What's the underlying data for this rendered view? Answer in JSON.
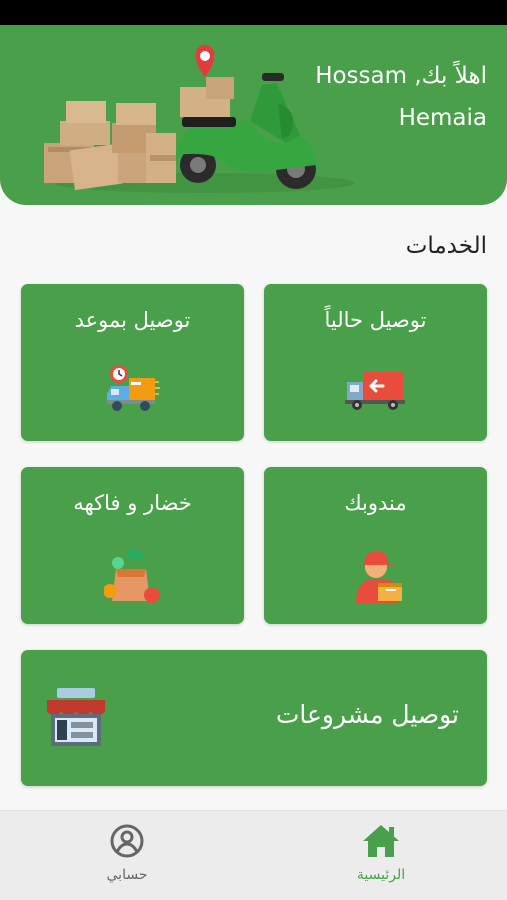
{
  "header": {
    "greeting_line1": "اهلاً بك, Hossam",
    "greeting_line2": "Hemaia"
  },
  "services": {
    "title": "الخدمات",
    "items": [
      {
        "label": "توصيل حالياً",
        "icon": "delivery-truck-icon"
      },
      {
        "label": "توصيل بموعد",
        "icon": "scheduled-delivery-icon"
      },
      {
        "label": "مندوبك",
        "icon": "courier-icon"
      },
      {
        "label": "خضار و فاكهه",
        "icon": "vegetables-fruits-icon"
      },
      {
        "label": "توصيل مشروعات",
        "icon": "shop-icon"
      }
    ]
  },
  "nav": {
    "home_label": "الرئيسية",
    "account_label": "حسابي"
  },
  "colors": {
    "primary": "#4aa04a",
    "background": "#f7f7f7",
    "nav_background": "#ececec",
    "nav_active": "#4aa04a",
    "nav_inactive": "#666666"
  }
}
